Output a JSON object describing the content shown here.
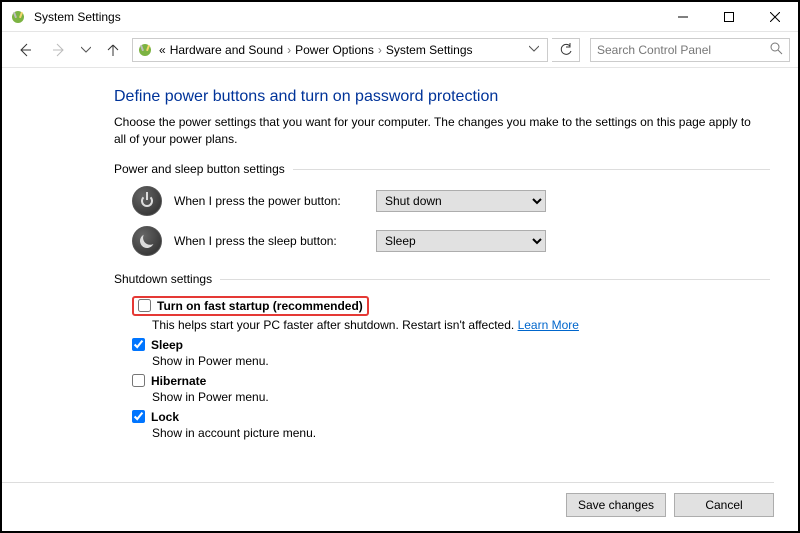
{
  "window": {
    "title": "System Settings"
  },
  "breadcrumbs": {
    "prefix_glyph": "«",
    "items": [
      "Hardware and Sound",
      "Power Options",
      "System Settings"
    ]
  },
  "search": {
    "placeholder": "Search Control Panel"
  },
  "page": {
    "heading": "Define power buttons and turn on password protection",
    "description": "Choose the power settings that you want for your computer. The changes you make to the settings on this page apply to all of your power plans."
  },
  "button_section": {
    "title": "Power and sleep button settings",
    "power_label": "When I press the power button:",
    "power_value": "Shut down",
    "sleep_label": "When I press the sleep button:",
    "sleep_value": "Sleep"
  },
  "shutdown_section": {
    "title": "Shutdown settings",
    "items": [
      {
        "label": "Turn on fast startup (recommended)",
        "checked": false,
        "sub": "This helps start your PC faster after shutdown. Restart isn't affected.",
        "learn_more": "Learn More",
        "highlighted": true
      },
      {
        "label": "Sleep",
        "checked": true,
        "sub": "Show in Power menu."
      },
      {
        "label": "Hibernate",
        "checked": false,
        "sub": "Show in Power menu."
      },
      {
        "label": "Lock",
        "checked": true,
        "sub": "Show in account picture menu."
      }
    ]
  },
  "footer": {
    "save": "Save changes",
    "cancel": "Cancel"
  }
}
